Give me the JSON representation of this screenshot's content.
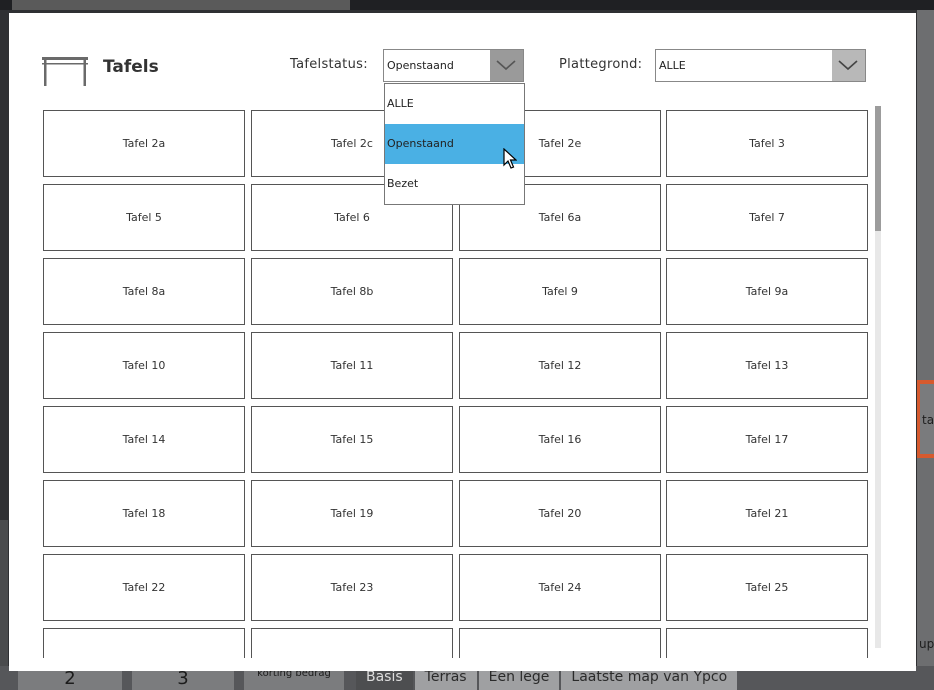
{
  "background": {
    "keys": [
      "2",
      "3",
      "korting bedrag"
    ],
    "tabs": [
      {
        "label": "Basis",
        "active": true
      },
      {
        "label": "Terras",
        "active": false
      },
      {
        "label": "Een lege",
        "active": false
      },
      {
        "label": "Laatste map van Ypco",
        "active": false
      }
    ],
    "side_fragments": [
      "ta",
      "up"
    ]
  },
  "modal": {
    "title": "Tafels",
    "title_icon": "table-icon",
    "status_label": "Tafelstatus:",
    "status_value": "Openstaand",
    "plattegrond_label": "Plattegrond:",
    "plattegrond_value": "ALLE",
    "status_options": [
      {
        "label": "ALLE",
        "selected": false
      },
      {
        "label": "Openstaand",
        "selected": true
      },
      {
        "label": "Bezet",
        "selected": false
      }
    ],
    "tables": [
      "Tafel 2a",
      "Tafel 2c",
      "Tafel 2e",
      "Tafel 3",
      "Tafel 5",
      "Tafel 6",
      "Tafel 6a",
      "Tafel 7",
      "Tafel 8a",
      "Tafel 8b",
      "Tafel 9",
      "Tafel 9a",
      "Tafel 10",
      "Tafel 11",
      "Tafel 12",
      "Tafel 13",
      "Tafel 14",
      "Tafel 15",
      "Tafel 16",
      "Tafel 17",
      "Tafel 18",
      "Tafel 19",
      "Tafel 20",
      "Tafel 21",
      "Tafel 22",
      "Tafel 23",
      "Tafel 24",
      "Tafel 25",
      "",
      "",
      "",
      ""
    ]
  },
  "colors": {
    "selected_option": "#4ab0e4",
    "accent_orange": "#d65a2e"
  }
}
